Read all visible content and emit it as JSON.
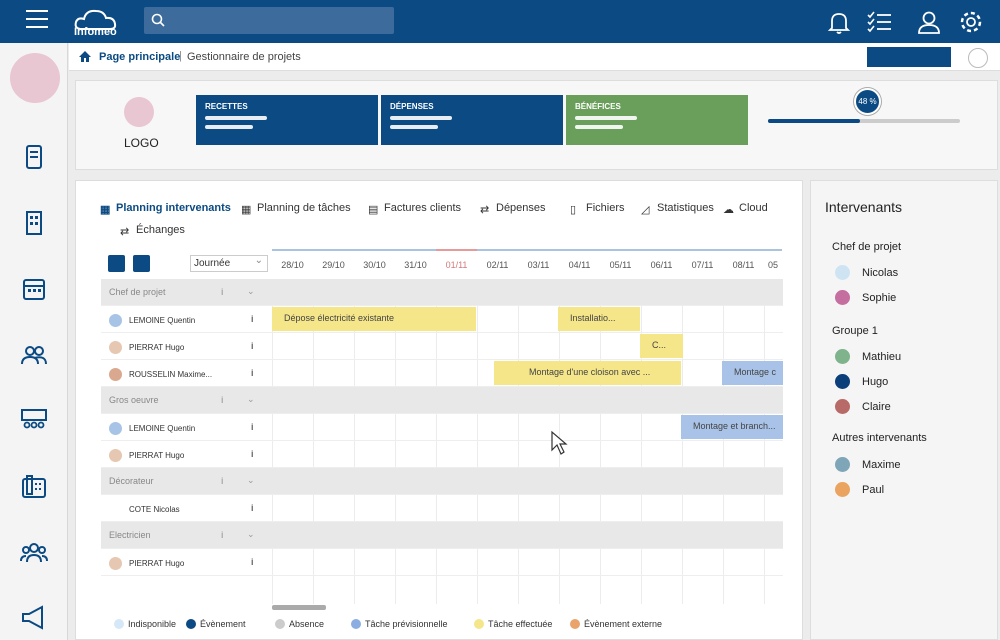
{
  "app": {
    "brand": "Infomeo",
    "search_placeholder": ""
  },
  "breadcrumb": {
    "home": "Page principale",
    "sep": "|",
    "current": "Gestionnaire de projets"
  },
  "summary": {
    "logo": "LOGO",
    "cards": [
      {
        "title": "RECETTES",
        "color": "#0b4a82"
      },
      {
        "title": "DÉPENSES",
        "color": "#0b4a82"
      },
      {
        "title": "BÉNÉFICES",
        "color": "#6a9e5b"
      }
    ],
    "progress": {
      "label": "48 %",
      "value": 0.48
    }
  },
  "tabs": [
    {
      "label": "Planning intervenants",
      "icon": "calendar-icon",
      "active": true
    },
    {
      "label": "Planning de tâches",
      "icon": "calendar-icon"
    },
    {
      "label": "Factures clients",
      "icon": "invoice-icon"
    },
    {
      "label": "Dépenses",
      "icon": "exchange-icon"
    },
    {
      "label": "Fichiers",
      "icon": "file-icon"
    },
    {
      "label": "Statistiques",
      "icon": "chart-icon"
    },
    {
      "label": "Cloud",
      "icon": "cloud-icon"
    },
    {
      "label": "Échanges",
      "icon": "exchange-icon"
    }
  ],
  "planning": {
    "view": "Journée",
    "dates": [
      "28/10",
      "29/10",
      "30/10",
      "31/10",
      "01/11",
      "02/11",
      "03/11",
      "04/11",
      "05/11",
      "06/11",
      "07/11",
      "08/11",
      "05"
    ],
    "highlight_date": "01/11",
    "rows": [
      {
        "type": "group",
        "label": "Chef de projet"
      },
      {
        "type": "person",
        "label": "LEMOINE Quentin"
      },
      {
        "type": "person",
        "label": "PIERRAT Hugo"
      },
      {
        "type": "person",
        "label": "ROUSSELIN Maxime..."
      },
      {
        "type": "group",
        "label": "Gros oeuvre"
      },
      {
        "type": "person",
        "label": "LEMOINE Quentin"
      },
      {
        "type": "person",
        "label": "PIERRAT Hugo"
      },
      {
        "type": "group",
        "label": "Décorateur"
      },
      {
        "type": "person",
        "label": "COTE Nicolas"
      },
      {
        "type": "group",
        "label": "Electricien"
      },
      {
        "type": "person",
        "label": "PIERRAT Hugo"
      }
    ],
    "tasks": [
      {
        "label": "Dépose électricité existante",
        "type": "y"
      },
      {
        "label": "Installatio...",
        "type": "y"
      },
      {
        "label": "C...",
        "type": "y"
      },
      {
        "label": "",
        "type": "y"
      },
      {
        "label": "Montage d'une cloison avec ...",
        "type": "y"
      },
      {
        "label": "Montage c",
        "type": "b"
      },
      {
        "label": "Montage et branch...",
        "type": "b"
      }
    ]
  },
  "legend": [
    {
      "label": "Indisponible",
      "color": "#d6e8f7"
    },
    {
      "label": "Évènement",
      "color": "#0b4a82"
    },
    {
      "label": "Absence",
      "color": "#cccccc"
    },
    {
      "label": "Tâche prévisionnelle",
      "color": "#8aaee0"
    },
    {
      "label": "Tâche effectuée",
      "color": "#f5e68a"
    },
    {
      "label": "Évènement externe",
      "color": "#e9a46c"
    }
  ],
  "intervenants": {
    "title": "Intervenants",
    "groups": [
      {
        "name": "Chef de projet",
        "people": [
          {
            "name": "Nicolas",
            "color": "#cfe4f3"
          },
          {
            "name": "Sophie",
            "color": "#c56ea0"
          }
        ]
      },
      {
        "name": "Groupe 1",
        "people": [
          {
            "name": "Mathieu",
            "color": "#7fb38c"
          },
          {
            "name": "Hugo",
            "color": "#0b3f7a"
          },
          {
            "name": "Claire",
            "color": "#b86a68"
          }
        ]
      },
      {
        "name": "Autres intervenants",
        "people": [
          {
            "name": "Maxime",
            "color": "#7fa6b8"
          },
          {
            "name": "Paul",
            "color": "#eaa460"
          }
        ]
      }
    ]
  }
}
